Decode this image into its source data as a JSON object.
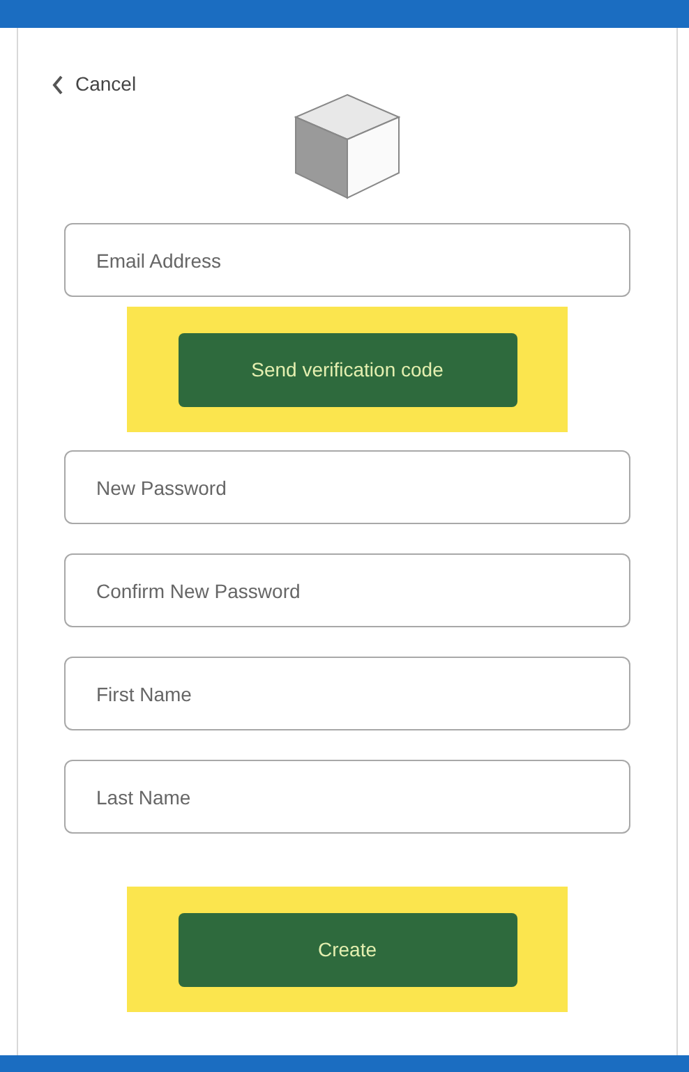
{
  "cancel": {
    "label": "Cancel"
  },
  "items": [
    {
      "kind": "field",
      "placeholder": "Email Address"
    },
    {
      "kind": "button",
      "label": "Send verification code",
      "highlighted": true
    },
    {
      "kind": "field",
      "placeholder": "New Password"
    },
    {
      "kind": "field",
      "placeholder": "Confirm New Password"
    },
    {
      "kind": "field",
      "placeholder": "First Name"
    },
    {
      "kind": "field",
      "placeholder": "Last Name"
    },
    {
      "kind": "button",
      "label": "Create",
      "highlighted": true
    }
  ]
}
